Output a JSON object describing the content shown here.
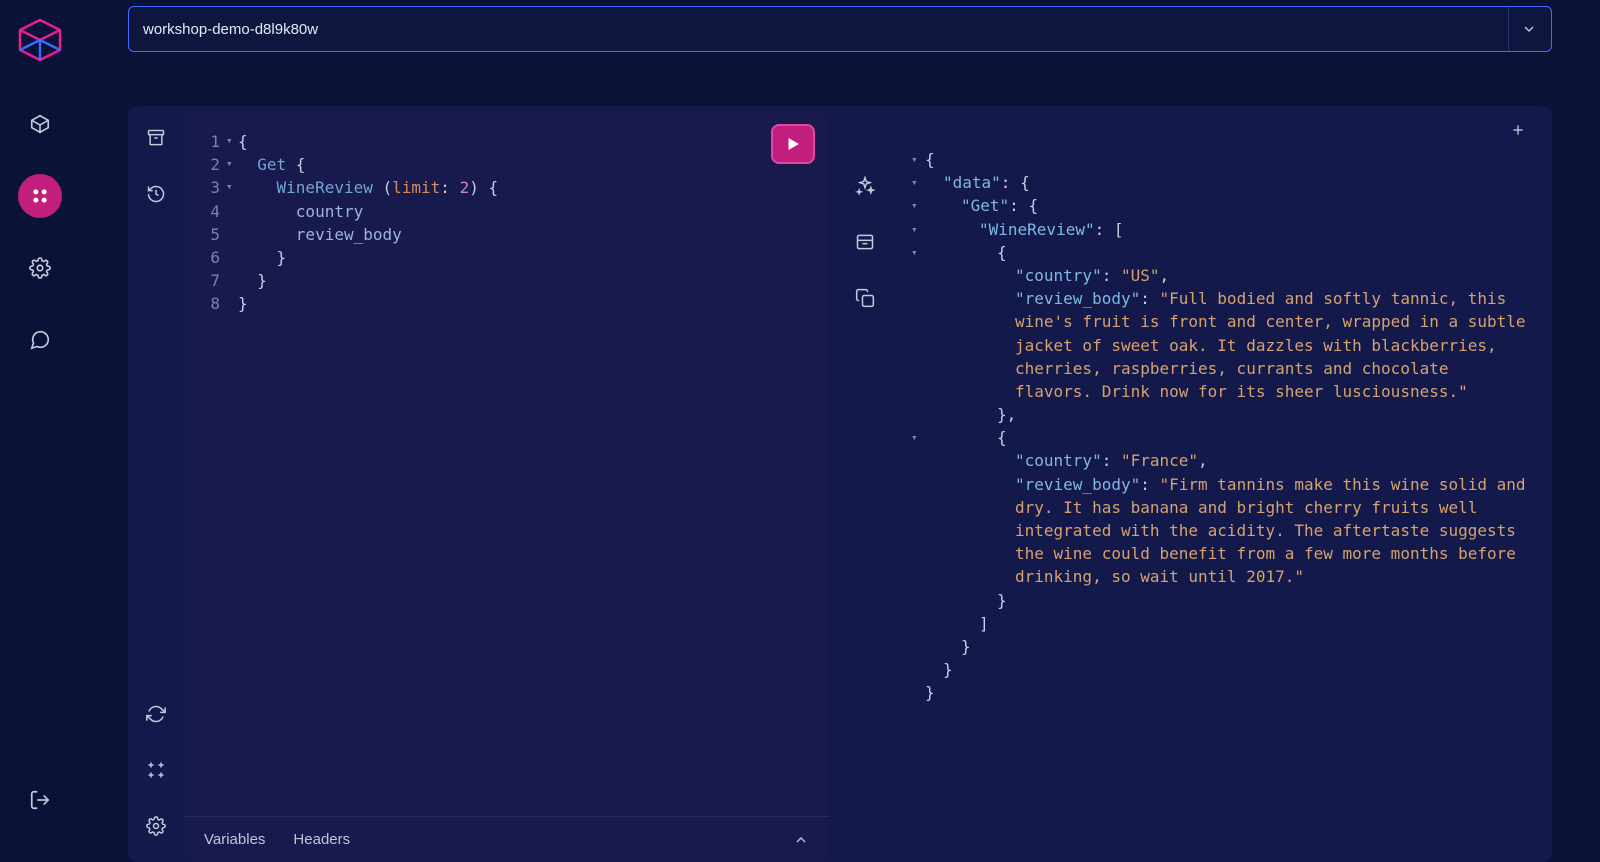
{
  "header": {
    "instance_name": "workshop-demo-d8l9k80w"
  },
  "nav": {
    "logo": "weaviate-logo",
    "items": [
      "cube-icon",
      "grid-icon",
      "gear-icon",
      "chat-icon"
    ],
    "active_index": 1,
    "exit": "logout-icon"
  },
  "tool_col": {
    "top": [
      "archive-icon",
      "history-icon"
    ],
    "bottom": [
      "refresh-icon",
      "keyboard-icon",
      "gear-icon"
    ]
  },
  "util_col": [
    "sparkle-icon",
    "layout-icon",
    "copy-icon"
  ],
  "query": {
    "lines": [
      {
        "n": "1",
        "fold": "▾",
        "tokens": [
          [
            "brace",
            "{"
          ]
        ]
      },
      {
        "n": "2",
        "fold": "▾",
        "indent": 1,
        "tokens": [
          [
            "key",
            "Get"
          ],
          [
            "brace",
            " {"
          ]
        ]
      },
      {
        "n": "3",
        "fold": "▾",
        "indent": 2,
        "tokens": [
          [
            "key",
            "WineReview"
          ],
          [
            "brace",
            " ("
          ],
          [
            "arg",
            "limit"
          ],
          [
            "brace",
            ": "
          ],
          [
            "num",
            "2"
          ],
          [
            "brace",
            ") {"
          ]
        ]
      },
      {
        "n": "4",
        "fold": "",
        "indent": 3,
        "tokens": [
          [
            "field",
            "country"
          ]
        ]
      },
      {
        "n": "5",
        "fold": "",
        "indent": 3,
        "tokens": [
          [
            "field",
            "review_body"
          ]
        ]
      },
      {
        "n": "6",
        "fold": "",
        "indent": 2,
        "tokens": [
          [
            "brace",
            "}"
          ]
        ]
      },
      {
        "n": "7",
        "fold": "",
        "indent": 1,
        "tokens": [
          [
            "brace",
            "}"
          ]
        ]
      },
      {
        "n": "8",
        "fold": "",
        "indent": 0,
        "tokens": [
          [
            "brace",
            "}"
          ]
        ]
      }
    ]
  },
  "footer_tabs": {
    "variables": "Variables",
    "headers": "Headers"
  },
  "run_button": "Run",
  "result": {
    "add": "+",
    "lines": [
      {
        "fold": "▾",
        "indent": 0,
        "segs": [
          [
            "punc",
            "{"
          ]
        ]
      },
      {
        "fold": "▾",
        "indent": 1,
        "segs": [
          [
            "key",
            "\"data\""
          ],
          [
            "punc",
            ": {"
          ]
        ]
      },
      {
        "fold": "▾",
        "indent": 2,
        "segs": [
          [
            "key",
            "\"Get\""
          ],
          [
            "punc",
            ": {"
          ]
        ]
      },
      {
        "fold": "▾",
        "indent": 3,
        "segs": [
          [
            "key",
            "\"WineReview\""
          ],
          [
            "punc",
            ": ["
          ]
        ]
      },
      {
        "fold": "▾",
        "indent": 4,
        "segs": [
          [
            "punc",
            "{"
          ]
        ]
      },
      {
        "fold": "",
        "indent": 5,
        "segs": [
          [
            "key",
            "\"country\""
          ],
          [
            "punc",
            ": "
          ],
          [
            "str",
            "\"US\""
          ],
          [
            "punc",
            ","
          ]
        ]
      },
      {
        "fold": "",
        "indent": 5,
        "segs": [
          [
            "key",
            "\"review_body\""
          ],
          [
            "punc",
            ": "
          ],
          [
            "str",
            "\"Full bodied and softly tannic, this wine's fruit is front and center, wrapped in a subtle jacket of sweet oak. It dazzles with blackberries, cherries, raspberries, currants and chocolate flavors. Drink now for its sheer lusciousness.\""
          ]
        ]
      },
      {
        "fold": "",
        "indent": 4,
        "segs": [
          [
            "punc",
            "},"
          ]
        ]
      },
      {
        "fold": "▾",
        "indent": 4,
        "segs": [
          [
            "punc",
            "{"
          ]
        ]
      },
      {
        "fold": "",
        "indent": 5,
        "segs": [
          [
            "key",
            "\"country\""
          ],
          [
            "punc",
            ": "
          ],
          [
            "str",
            "\"France\""
          ],
          [
            "punc",
            ","
          ]
        ]
      },
      {
        "fold": "",
        "indent": 5,
        "segs": [
          [
            "key",
            "\"review_body\""
          ],
          [
            "punc",
            ": "
          ],
          [
            "str",
            "\"Firm tannins make this wine solid and dry. It has banana and bright cherry fruits well integrated with the acidity. The aftertaste suggests the wine could benefit from a few more months before drinking, so wait until 2017.\""
          ]
        ]
      },
      {
        "fold": "",
        "indent": 4,
        "segs": [
          [
            "punc",
            "}"
          ]
        ]
      },
      {
        "fold": "",
        "indent": 3,
        "segs": [
          [
            "punc",
            "]"
          ]
        ]
      },
      {
        "fold": "",
        "indent": 2,
        "segs": [
          [
            "punc",
            "}"
          ]
        ]
      },
      {
        "fold": "",
        "indent": 1,
        "segs": [
          [
            "punc",
            "}"
          ]
        ]
      },
      {
        "fold": "",
        "indent": 0,
        "segs": [
          [
            "punc",
            "}"
          ]
        ]
      }
    ]
  }
}
